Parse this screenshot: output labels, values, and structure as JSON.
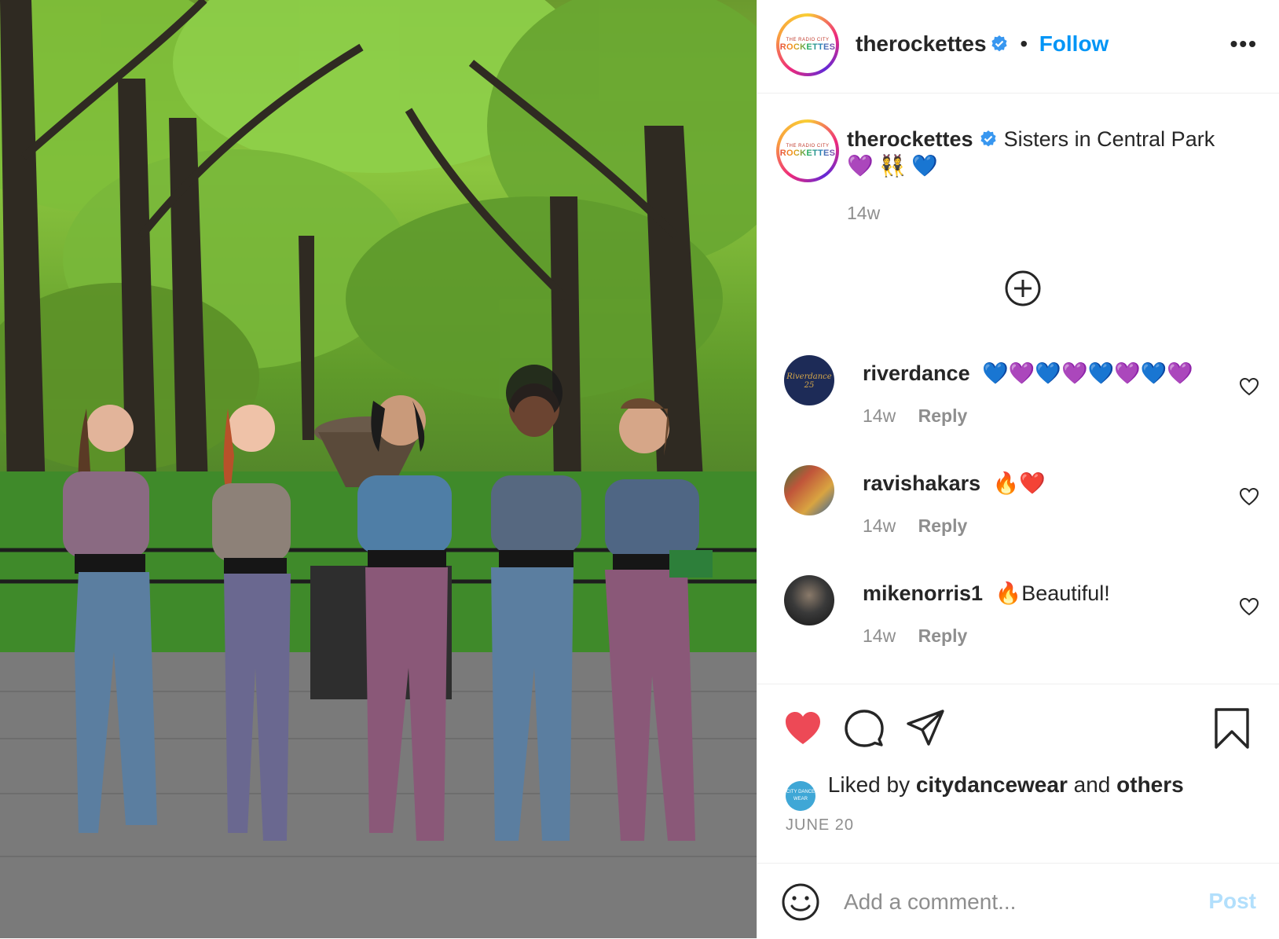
{
  "post": {
    "username": "therockettes",
    "follow_label": "Follow",
    "dot": "•",
    "more": "•••",
    "avatar_small": "THE RADIO CITY",
    "avatar_big": "ROCKETTES",
    "caption_text": "Sisters in Central Park",
    "caption_emoji": "💜 👯 💙",
    "caption_time": "14w",
    "accent_color": "#0095f6"
  },
  "comments": [
    {
      "user": "riverdance",
      "text": "💙💜💙💜💙💜💙💜",
      "time": "14w",
      "reply": "Reply",
      "avatar_label": "Riverdance 25"
    },
    {
      "user": "ravishakars",
      "text": "🔥❤️",
      "time": "14w",
      "reply": "Reply"
    },
    {
      "user": "mikenorris1",
      "text": "🔥Beautiful!",
      "time": "14w",
      "reply": "Reply"
    }
  ],
  "likes": {
    "prefix": "Liked by",
    "user": "citydancewear",
    "middle": "and",
    "suffix": "others",
    "avatar_label": "CITY DANCE WEAR",
    "date": "JUNE 20",
    "liked_color": "#ed4956"
  },
  "add_comment": {
    "placeholder": "Add a comment...",
    "post_label": "Post"
  },
  "icons": [
    "heart-icon",
    "comment-icon",
    "share-icon",
    "bookmark-icon",
    "plus-circle-icon",
    "emoji-icon",
    "verified-icon",
    "more-icon"
  ]
}
